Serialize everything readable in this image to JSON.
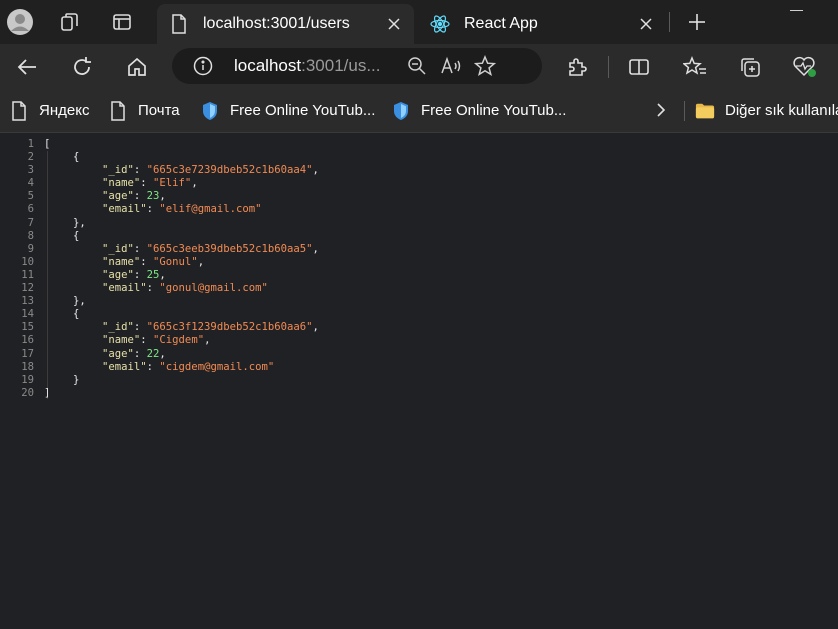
{
  "tabs": [
    {
      "title": "localhost:3001/users",
      "active": true,
      "icon": "page-icon"
    },
    {
      "title": "React App",
      "active": false,
      "icon": "react-icon"
    }
  ],
  "address_bar": {
    "host": "localhost",
    "rest": ":3001/us..."
  },
  "bookmarks": [
    {
      "label": "Яндекс",
      "icon": "page-icon"
    },
    {
      "label": "Почта",
      "icon": "page-icon"
    },
    {
      "label": "Free Online YouTub...",
      "icon": "shield-icon"
    },
    {
      "label": "Free Online YouTub...",
      "icon": "shield-icon"
    }
  ],
  "bookmarks_overflow_label": "Diğer sık kullanılanlar",
  "json_lines": [
    {
      "n": "1",
      "indent": 0,
      "text": "["
    },
    {
      "n": "2",
      "indent": 1,
      "text": "{"
    },
    {
      "n": "3",
      "indent": 2,
      "key": "_id",
      "value": "\"665c3e7239dbeb52c1b60aa4\"",
      "vtype": "str",
      "comma": true
    },
    {
      "n": "4",
      "indent": 2,
      "key": "name",
      "value": "\"Elif\"",
      "vtype": "str",
      "comma": true
    },
    {
      "n": "5",
      "indent": 2,
      "key": "age",
      "value": "23",
      "vtype": "num",
      "comma": true
    },
    {
      "n": "6",
      "indent": 2,
      "key": "email",
      "value": "\"elif@gmail.com\"",
      "vtype": "str",
      "comma": false
    },
    {
      "n": "7",
      "indent": 1,
      "text": "},"
    },
    {
      "n": "8",
      "indent": 1,
      "text": "{"
    },
    {
      "n": "9",
      "indent": 2,
      "key": "_id",
      "value": "\"665c3eeb39dbeb52c1b60aa5\"",
      "vtype": "str",
      "comma": true
    },
    {
      "n": "10",
      "indent": 2,
      "key": "name",
      "value": "\"Gonul\"",
      "vtype": "str",
      "comma": true
    },
    {
      "n": "11",
      "indent": 2,
      "key": "age",
      "value": "25",
      "vtype": "num",
      "comma": true
    },
    {
      "n": "12",
      "indent": 2,
      "key": "email",
      "value": "\"gonul@gmail.com\"",
      "vtype": "str",
      "comma": false
    },
    {
      "n": "13",
      "indent": 1,
      "text": "},"
    },
    {
      "n": "14",
      "indent": 1,
      "text": "{"
    },
    {
      "n": "15",
      "indent": 2,
      "key": "_id",
      "value": "\"665c3f1239dbeb52c1b60aa6\"",
      "vtype": "str",
      "comma": true
    },
    {
      "n": "16",
      "indent": 2,
      "key": "name",
      "value": "\"Cigdem\"",
      "vtype": "str",
      "comma": true
    },
    {
      "n": "17",
      "indent": 2,
      "key": "age",
      "value": "22",
      "vtype": "num",
      "comma": true
    },
    {
      "n": "18",
      "indent": 2,
      "key": "email",
      "value": "\"cigdem@gmail.com\"",
      "vtype": "str",
      "comma": false
    },
    {
      "n": "19",
      "indent": 1,
      "text": "}"
    },
    {
      "n": "20",
      "indent": 0,
      "text": "]"
    }
  ],
  "colors": {
    "key": "#e5e0a8",
    "string": "#f28b54",
    "number": "#7ee787",
    "background": "#202124"
  }
}
